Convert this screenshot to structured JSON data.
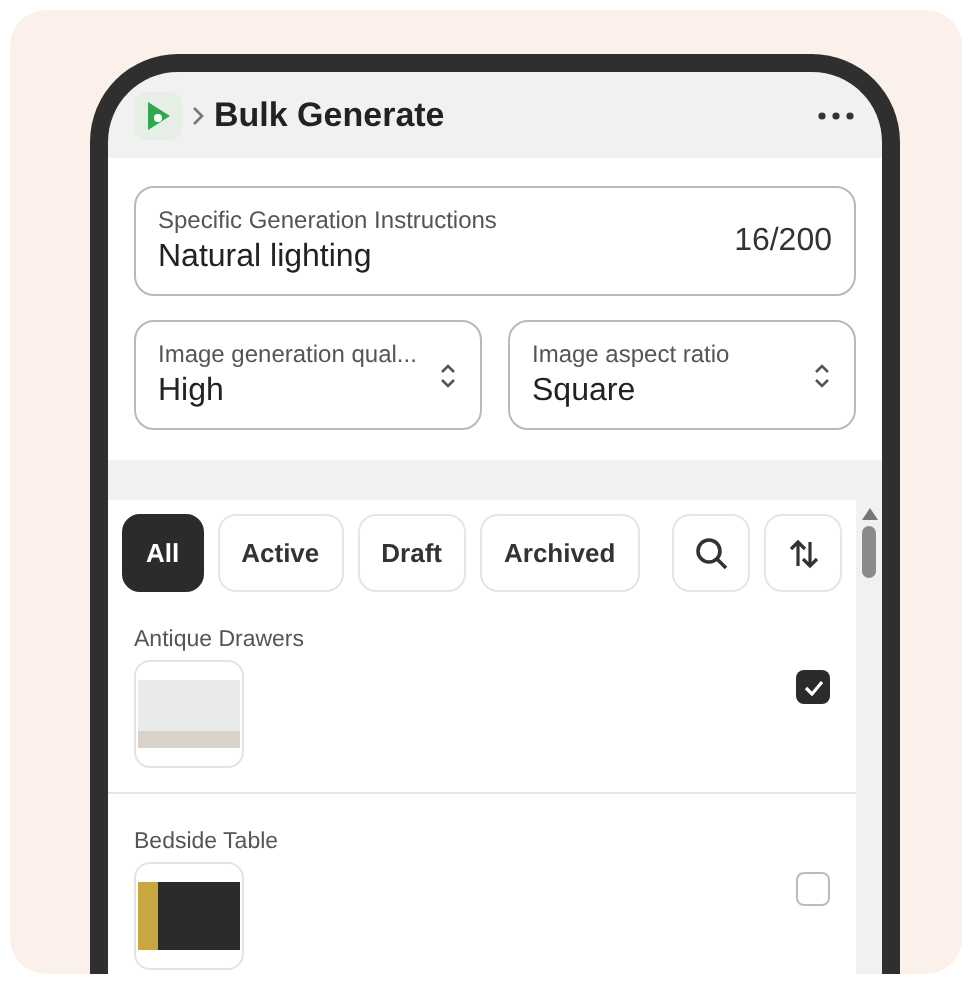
{
  "header": {
    "title": "Bulk Generate"
  },
  "instructions": {
    "label": "Specific Generation Instructions",
    "value": "Natural lighting",
    "counter": "16/200"
  },
  "selects": [
    {
      "label": "Image generation qual...",
      "value": "High"
    },
    {
      "label": "Image aspect ratio",
      "value": "Square"
    }
  ],
  "filters": [
    {
      "label": "All",
      "selected": true
    },
    {
      "label": "Active",
      "selected": false
    },
    {
      "label": "Draft",
      "selected": false
    },
    {
      "label": "Archived",
      "selected": false
    }
  ],
  "products": [
    {
      "name": "Antique Drawers",
      "checked": true,
      "kind": "light"
    },
    {
      "name": "Bedside Table",
      "checked": false,
      "kind": "dark"
    }
  ]
}
